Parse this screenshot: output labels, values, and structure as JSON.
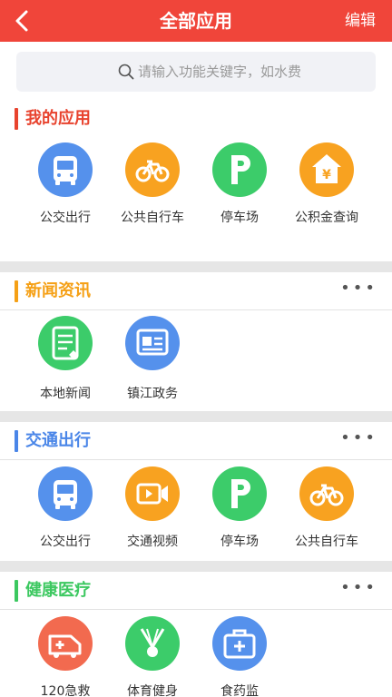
{
  "header": {
    "title": "全部应用",
    "edit_label": "编辑"
  },
  "search": {
    "placeholder": "请输入功能关键字，如水费"
  },
  "sections": {
    "my_apps": {
      "title": "我的应用",
      "color": "#e8432e",
      "apps": [
        {
          "label": "公交出行",
          "icon": "bus-icon",
          "color": "#5591ec"
        },
        {
          "label": "公共自行车",
          "icon": "bicycle-icon",
          "color": "#f8a220"
        },
        {
          "label": "停车场",
          "icon": "parking-icon",
          "color": "#3ccc6a"
        },
        {
          "label": "公积金查询",
          "icon": "housing-fund-icon",
          "color": "#f8a220"
        }
      ]
    },
    "news": {
      "title": "新闻资讯",
      "color": "#f5a016",
      "more": "•••",
      "apps": [
        {
          "label": "本地新闻",
          "icon": "news-icon",
          "color": "#3ccc6a"
        },
        {
          "label": "镇江政务",
          "icon": "government-icon",
          "color": "#5591ec"
        }
      ]
    },
    "transport": {
      "title": "交通出行",
      "color": "#4a86e8",
      "more": "•••",
      "apps": [
        {
          "label": "公交出行",
          "icon": "bus-icon",
          "color": "#5591ec"
        },
        {
          "label": "交通视频",
          "icon": "video-camera-icon",
          "color": "#f8a220"
        },
        {
          "label": "停车场",
          "icon": "parking-icon",
          "color": "#3ccc6a"
        },
        {
          "label": "公共自行车",
          "icon": "bicycle-icon",
          "color": "#f8a220"
        }
      ]
    },
    "health": {
      "title": "健康医疗",
      "color": "#3cc860",
      "more": "•••",
      "apps": [
        {
          "label": "120急救",
          "icon": "ambulance-icon",
          "color": "#f26a4f"
        },
        {
          "label": "体育健身",
          "icon": "badminton-icon",
          "color": "#3ccc6a"
        },
        {
          "label": "食药监",
          "icon": "medical-kit-icon",
          "color": "#5591ec"
        }
      ]
    }
  }
}
